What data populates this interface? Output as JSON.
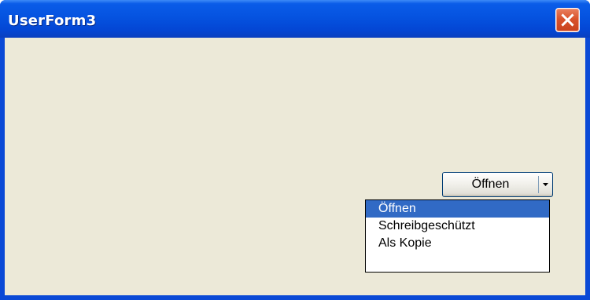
{
  "window": {
    "title": "UserForm3",
    "close_icon": "close-icon"
  },
  "split_button": {
    "label": "Öffnen",
    "arrow_icon": "dropdown-arrow-icon"
  },
  "menu": {
    "items": [
      {
        "label": "Öffnen",
        "selected": true
      },
      {
        "label": "Schreibgeschützt",
        "selected": false
      },
      {
        "label": "Als Kopie",
        "selected": false
      }
    ]
  },
  "colors": {
    "titlebar": "#0553e0",
    "client_background": "#ece9d8",
    "selection": "#316ac5",
    "close_button": "#d9532c"
  }
}
